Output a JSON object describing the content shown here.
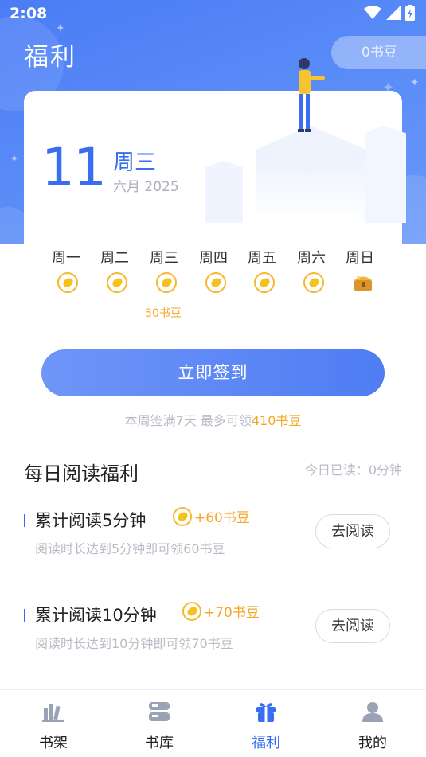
{
  "status_bar": {
    "time": "2:08"
  },
  "header": {
    "title": "福利",
    "bean_balance": "0书豆"
  },
  "date_card": {
    "day": "11",
    "weekday": "周三",
    "month_year": "六月 2025"
  },
  "week": {
    "days": [
      "周一",
      "周二",
      "周三",
      "周四",
      "周五",
      "周六",
      "周日"
    ],
    "today_reward": "50书豆"
  },
  "sign_in": {
    "button_label": "立即签到",
    "hint_prefix": "本周签满7天 最多可领",
    "hint_highlight": "410书豆"
  },
  "daily_reading": {
    "title": "每日阅读福利",
    "today_read": "今日已读：0分钟",
    "tasks": [
      {
        "name": "累计阅读5分钟",
        "reward": "+60书豆",
        "desc": "阅读时长达到5分钟即可领60书豆",
        "button": "去阅读"
      },
      {
        "name": "累计阅读10分钟",
        "reward": "+70书豆",
        "desc": "阅读时长达到10分钟即可领70书豆",
        "button": "去阅读"
      }
    ]
  },
  "tabbar": {
    "items": [
      {
        "label": "书架",
        "icon": "bookshelf-icon",
        "active": false
      },
      {
        "label": "书库",
        "icon": "library-icon",
        "active": false
      },
      {
        "label": "福利",
        "icon": "gift-icon",
        "active": true
      },
      {
        "label": "我的",
        "icon": "profile-icon",
        "active": false
      }
    ]
  },
  "colors": {
    "accent": "#3a6ef2",
    "reward": "#f5a623",
    "hero_bg": "#4a7cf5"
  }
}
